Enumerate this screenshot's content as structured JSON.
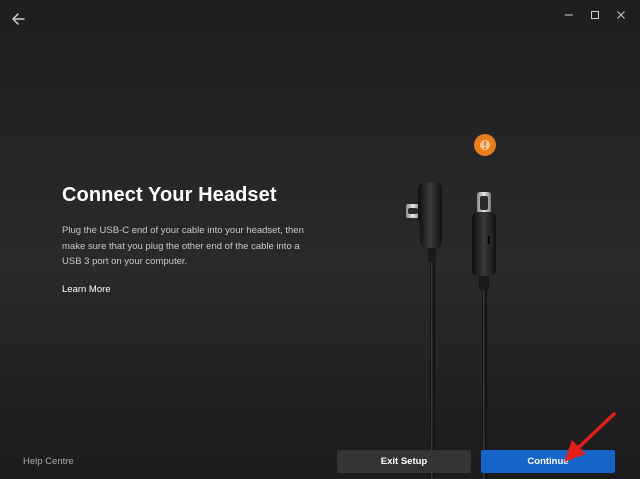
{
  "window": {
    "controls": [
      "minimize-icon",
      "maximize-icon",
      "close-icon"
    ]
  },
  "nav": {
    "back_icon": "back-arrow-icon"
  },
  "main": {
    "title": "Connect Your Headset",
    "description": "Plug the USB-C end of your cable into your headset, then make sure that you plug the other end of the cable into a USB 3 port on your computer.",
    "learn_more": "Learn More"
  },
  "illustration": {
    "alert_icon": "alert-icon",
    "alert_color": "#e87d1e"
  },
  "footer": {
    "help_label": "Help Centre",
    "exit_label": "Exit Setup",
    "continue_label": "Continue"
  },
  "colors": {
    "accent": "#1565c8",
    "annotation_arrow": "#e0201b"
  }
}
